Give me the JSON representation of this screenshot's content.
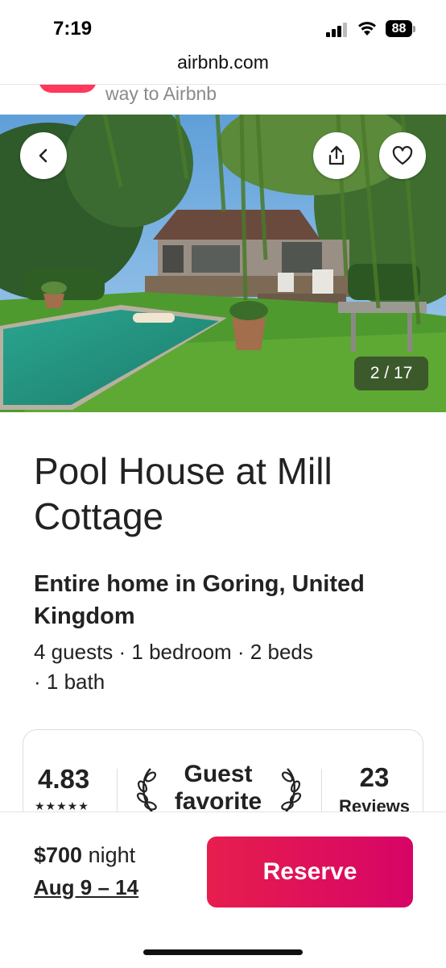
{
  "status_bar": {
    "time": "7:19",
    "battery": "88",
    "icons": [
      "signal-icon",
      "wifi-icon",
      "battery-icon"
    ]
  },
  "browser": {
    "url": "airbnb.com"
  },
  "banner": {
    "text": "way to Airbnb",
    "accent_color": "#ff385c"
  },
  "gallery": {
    "counter": "2 / 17",
    "current_index": 2,
    "total": 17,
    "icons": [
      "back-arrow-icon",
      "share-icon",
      "heart-icon"
    ]
  },
  "listing": {
    "title": "Pool House at Mill Cottage",
    "subtitle": "Entire home in Goring, United Kingdom",
    "details_line1": "4 guests · 1 bedroom · 2 beds",
    "details_line2": "· 1 bath"
  },
  "rating_card": {
    "rating": "4.83",
    "stars": "★★★★★",
    "badge_line1": "Guest",
    "badge_line2": "favorite",
    "reviews_count": "23",
    "reviews_label": "Reviews"
  },
  "footer": {
    "price": "$700",
    "price_unit": "night",
    "dates": "Aug 9 – 14",
    "reserve_label": "Reserve",
    "button_colors": [
      "#e61e4d",
      "#d70466"
    ]
  }
}
